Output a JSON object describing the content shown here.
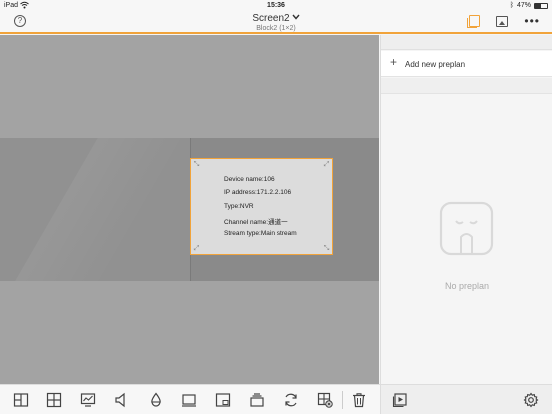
{
  "status_bar": {
    "carrier": "iPad",
    "time": "15:36",
    "battery_text": "47%",
    "battery_level": 0.47
  },
  "navbar": {
    "title": "Screen2",
    "subtitle": "Block2 (1×2)",
    "help_glyph": "?",
    "more_glyph": "•••"
  },
  "device_card": {
    "device_name": "Device name:106",
    "ip_address": "IP address:171.2.2.106",
    "type": "Type:NVR",
    "channel_name": "Channel name:通道一",
    "stream_type": "Stream type:Main stream"
  },
  "sidebar": {
    "add_glyph": "+",
    "add_label": "Add new preplan",
    "empty_text": "No preplan"
  },
  "toolbar": {
    "icons": [
      "layout-icon",
      "grid-icon",
      "monitor-chart-icon",
      "speaker-icon",
      "drop-icon",
      "screen-icon",
      "window-icon",
      "stack-icon",
      "refresh-icon",
      "grid-close-icon",
      "trash-icon",
      "play-window-icon",
      "settings-icon"
    ]
  },
  "colors": {
    "accent": "#f1a33a",
    "stage": "#a3a3a3",
    "panel": "#f5f5f5"
  }
}
